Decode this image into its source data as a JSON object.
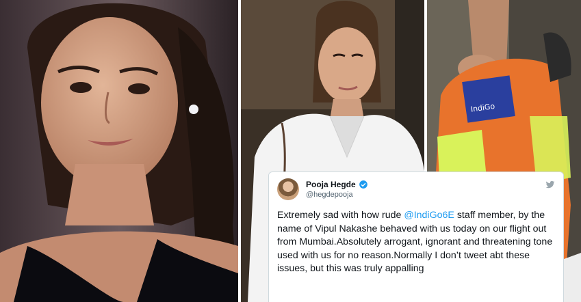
{
  "panels": [
    {
      "subject": "actress portrait at event"
    },
    {
      "subject": "actress at airport in white shirt"
    },
    {
      "subject": "staff member in orange IndiGo safety vest"
    }
  ],
  "vest_logo_text": "IndiGo",
  "tweet": {
    "author_name": "Pooja Hegde",
    "author_handle": "@hegdepooja",
    "verified": true,
    "text_before_mention": "Extremely sad with how rude ",
    "mention": "@IndiGo6E",
    "text_after_mention": " staff member, by the name of Vipul Nakashe behaved with us today on our flight out from Mumbai.Absolutely arrogant, ignorant and threatening tone used with us for no reason.Normally I don’t tweet abt these issues, but this was truly appalling",
    "icons": [
      "verified-badge-icon",
      "twitter-bird-icon"
    ],
    "colors": {
      "mention": "#1d9bf0",
      "text": "#0f1419",
      "handle": "#536471",
      "verified": "#1d9bf0"
    }
  }
}
